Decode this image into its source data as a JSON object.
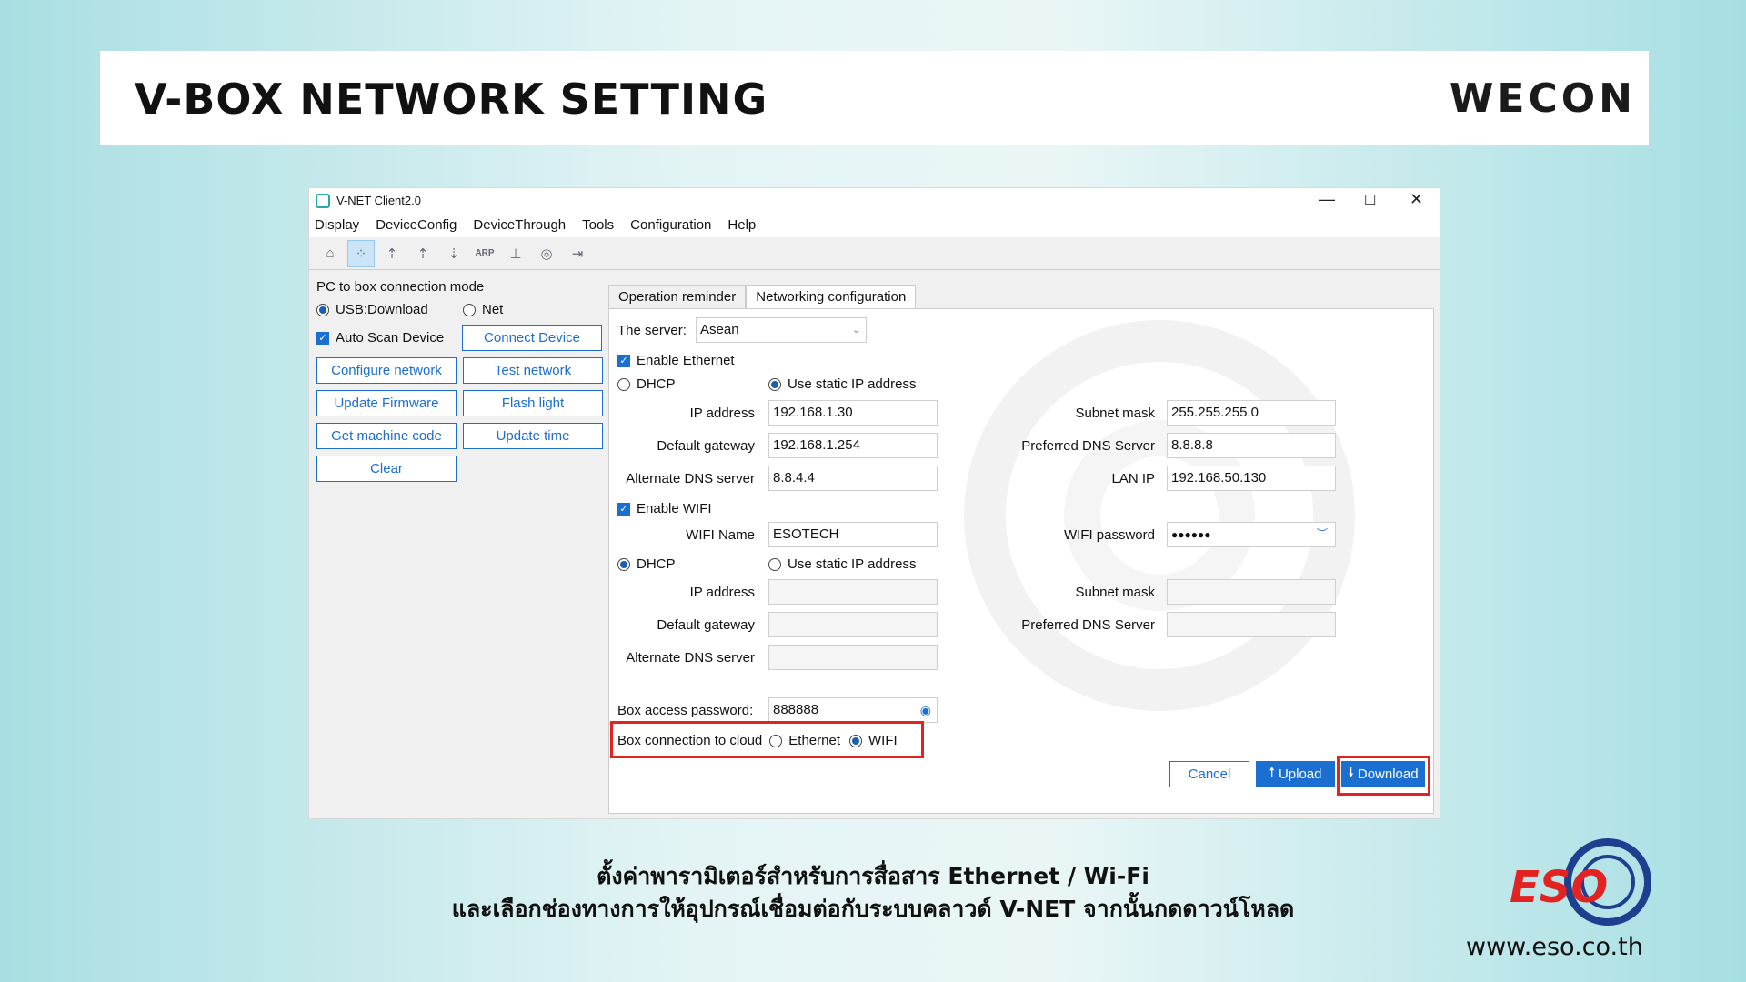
{
  "header": {
    "title": "V-BOX NETWORK SETTING",
    "brand": "WECON"
  },
  "window": {
    "title": "V-NET Client2.0",
    "controls": {
      "minimize": "—",
      "maximize": "☐",
      "close": "✕"
    },
    "menu": [
      "Display",
      "DeviceConfig",
      "DeviceThrough",
      "Tools",
      "Configuration",
      "Help"
    ],
    "toolbar_icons": [
      "home-icon",
      "network-icon",
      "plc-upload-icon",
      "vpn-upload-icon",
      "hmi-download-icon",
      "arp-icon",
      "tree-icon",
      "user-icon",
      "exit-icon"
    ]
  },
  "left_panel": {
    "mode_label": "PC to box connection mode",
    "usb_label": "USB:Download",
    "net_label": "Net",
    "auto_scan_label": "Auto Scan Device",
    "buttons": {
      "connect": "Connect Device",
      "configure": "Configure network",
      "test": "Test network",
      "firmware": "Update Firmware",
      "flash": "Flash light",
      "machine_code": "Get machine code",
      "update_time": "Update time",
      "clear": "Clear"
    }
  },
  "tabs": {
    "reminder": "Operation reminder",
    "networking": "Networking configuration"
  },
  "config": {
    "server_label": "The server:",
    "server_value": "Asean",
    "enable_ethernet": "Enable Ethernet",
    "dhcp": "DHCP",
    "static_ip": "Use static IP address",
    "ip_label": "IP address",
    "subnet_label": "Subnet mask",
    "gateway_label": "Default gateway",
    "pref_dns_label": "Preferred DNS Server",
    "alt_dns_label": "Alternate DNS server",
    "lan_ip_label": "LAN IP",
    "eth": {
      "ip": "192.168.1.30",
      "subnet": "255.255.255.0",
      "gateway": "192.168.1.254",
      "pref_dns": "8.8.8.8",
      "alt_dns": "8.8.4.4",
      "lan_ip": "192.168.50.130"
    },
    "enable_wifi": "Enable WIFI",
    "wifi_name_label": "WIFI Name",
    "wifi_name": "ESOTECH",
    "wifi_password_label": "WIFI password",
    "wifi_password": "●●●●●●",
    "box_password_label": "Box access password:",
    "box_password": "888888",
    "cloud_label": "Box connection to cloud",
    "cloud_ethernet": "Ethernet",
    "cloud_wifi": "WIFI",
    "cancel": "Cancel",
    "upload": "Upload",
    "download": "Download"
  },
  "caption": {
    "line1": "ตั้งค่าพารามิเตอร์สำหรับการสื่อสาร Ethernet / Wi-Fi",
    "line2": "และเลือกช่องทางการให้อุปกรณ์เชื่อมต่อกับระบบคลาวด์ V-NET จากนั้นกดดาวน์โหลด"
  },
  "footer": {
    "logo": "ESO",
    "website": "www.eso.co.th"
  },
  "colors": {
    "accent": "#1b6fd1",
    "highlight": "#e32222",
    "brand": "#2aa9a8"
  }
}
